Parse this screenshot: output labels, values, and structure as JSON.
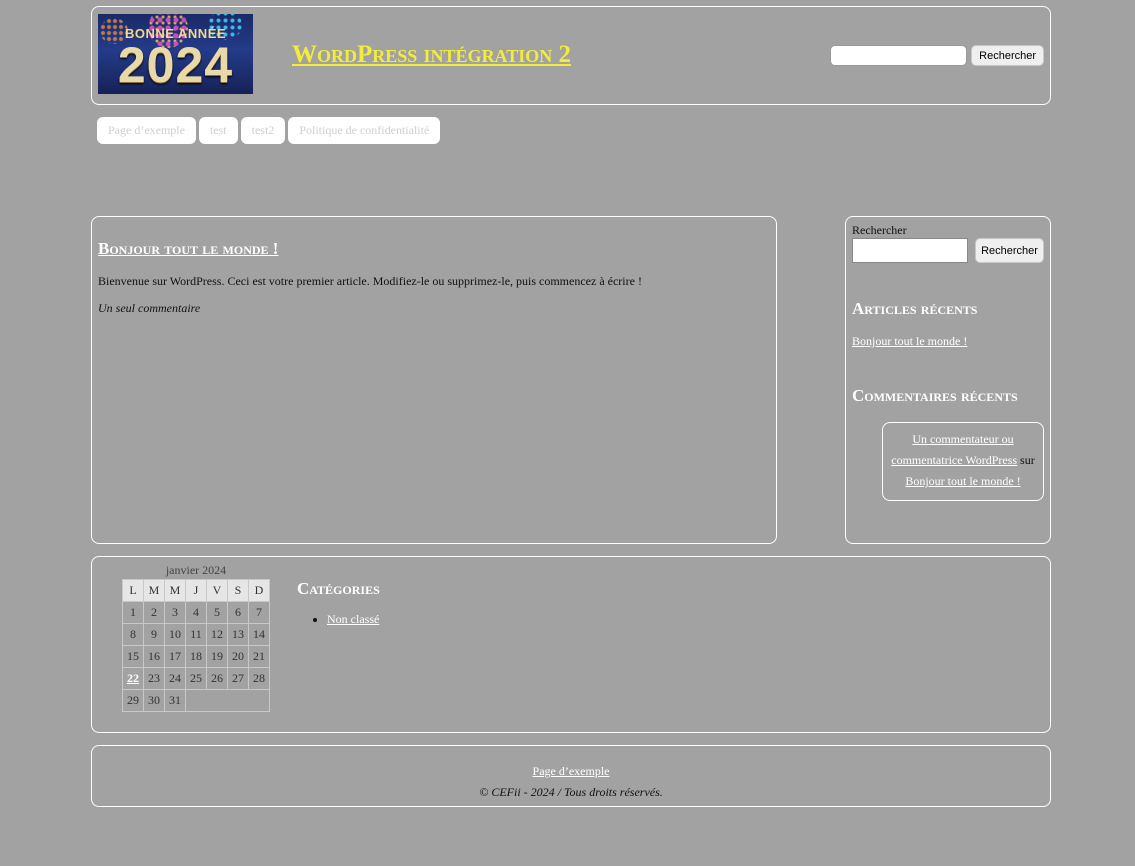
{
  "header": {
    "logo": {
      "line1": "BONNE ANNÉE",
      "line2": "2024"
    },
    "site_title": "WordPress intégration 2",
    "search_input_value": "",
    "search_button": "Rechercher"
  },
  "menu": {
    "items": [
      {
        "label": "Page d’exemple"
      },
      {
        "label": "test"
      },
      {
        "label": "test2"
      },
      {
        "label": "Politique de confidentialité"
      }
    ]
  },
  "main": {
    "post_title": "Bonjour tout le monde !",
    "post_excerpt": "Bienvenue sur WordPress. Ceci est votre premier article. Modifiez-le ou supprimez-le, puis commencez à écrire !",
    "post_comments": "Un seul commentaire"
  },
  "sidebar": {
    "search_label": "Rechercher",
    "search_input_value": "",
    "search_button": "Rechercher",
    "recent_posts_title": "Articles récents",
    "recent_posts": [
      "Bonjour tout le monde !"
    ],
    "recent_comments_title": "Commentaires récents",
    "recent_comment": {
      "author": "Un commentateur ou commentatrice WordPress",
      "connector": "sur",
      "post": "Bonjour tout le monde !"
    }
  },
  "widgets": {
    "calendar": {
      "caption": "janvier 2024",
      "weekdays": [
        "L",
        "M",
        "M",
        "J",
        "V",
        "S",
        "D"
      ],
      "weeks": [
        [
          "1",
          "2",
          "3",
          "4",
          "5",
          "6",
          "7"
        ],
        [
          "8",
          "9",
          "10",
          "11",
          "12",
          "13",
          "14"
        ],
        [
          "15",
          "16",
          "17",
          "18",
          "19",
          "20",
          "21"
        ],
        [
          "22",
          "23",
          "24",
          "25",
          "26",
          "27",
          "28"
        ],
        [
          "29",
          "30",
          "31"
        ]
      ],
      "today": "22"
    },
    "categories_title": "Catégories",
    "categories": [
      "Non classé"
    ]
  },
  "footer": {
    "link": "Page d’exemple",
    "copyright": "© CEFii - 2024 / Tous droits réservés."
  },
  "colors": {
    "page_background": "#a2a2a2",
    "site_title": "#f2ec3b",
    "border": "#ffffff",
    "link": "#ffffff"
  }
}
